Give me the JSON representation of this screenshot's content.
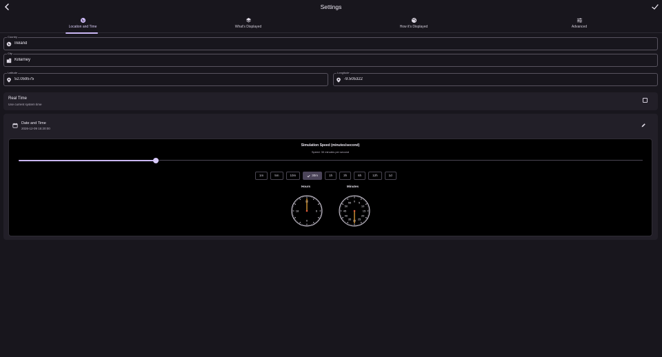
{
  "header": {
    "title": "Settings"
  },
  "tabs": [
    {
      "label": "Location and Time",
      "icon": "globe-icon",
      "active": true
    },
    {
      "label": "What's Displayed",
      "icon": "layers-icon",
      "active": false
    },
    {
      "label": "How it's Displayed",
      "icon": "palette-icon",
      "active": false
    },
    {
      "label": "Advanced",
      "icon": "sliders-icon",
      "active": false
    }
  ],
  "fields": {
    "country": {
      "label": "Country",
      "value": "Ireland"
    },
    "city": {
      "label": "City",
      "value": "Killarney"
    },
    "latitude": {
      "label": "Latitude",
      "value": "52.059575"
    },
    "longitude": {
      "label": "Longitude",
      "value": "-9.505322"
    }
  },
  "real_time": {
    "title": "Real Time",
    "subtitle": "Use current system time",
    "checked": false
  },
  "date_time": {
    "title": "Date and Time",
    "value": "2026-12-09 15:20:00"
  },
  "simulation": {
    "title": "Simulation Speed (minutes/second)",
    "subtitle": "Speed: 30 minutes per second",
    "slider_fraction": 0.22,
    "speeds": [
      "1m",
      "5m",
      "10m",
      "30m",
      "1h",
      "3h",
      "6h",
      "12h",
      "1d"
    ],
    "selected_speed": "30m"
  },
  "clocks": {
    "hours": {
      "label": "Hours",
      "marks": [
        "12",
        "6",
        "18",
        "0"
      ],
      "value": 0
    },
    "minutes": {
      "label": "Minutes",
      "marks": [
        "0",
        "5",
        "10",
        "15",
        "20",
        "25",
        "30",
        "35",
        "40",
        "45",
        "50",
        "55"
      ],
      "value": 30
    }
  },
  "colors": {
    "accent": "#cbb8f5",
    "background": "#18161d",
    "hand": "#e8a33a"
  }
}
